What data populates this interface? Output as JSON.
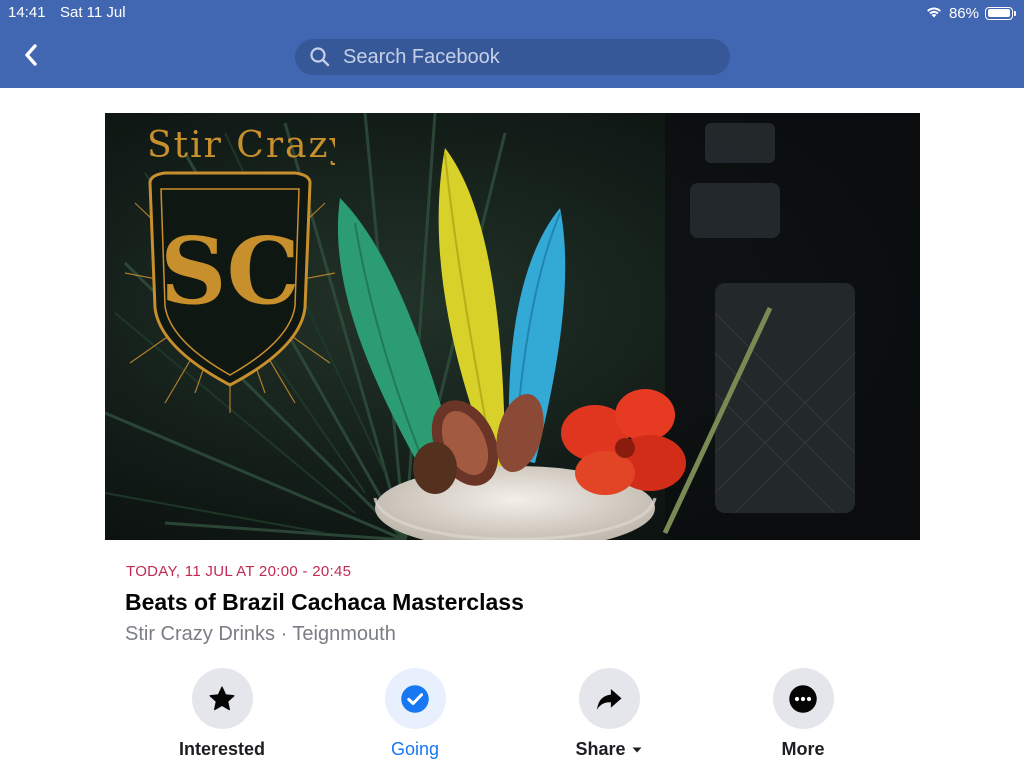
{
  "status_bar": {
    "time": "14:41",
    "date": "Sat 11 Jul",
    "battery": "86%",
    "battery_level": 0.86
  },
  "header": {
    "search_placeholder": "Search Facebook",
    "brand_color": "#4267b2"
  },
  "cover": {
    "logo_text": "Stir Crazy",
    "logo_monogram": "SC"
  },
  "event": {
    "date_time": "TODAY, 11 JUL AT 20:00 - 20:45",
    "title": "Beats of Brazil Cachaca Masterclass",
    "host": "Stir Crazy Drinks · Teignmouth"
  },
  "actions": [
    {
      "label": "Interested",
      "icon": "star-icon",
      "active": false
    },
    {
      "label": "Going",
      "icon": "check-circle-icon",
      "active": true
    },
    {
      "label": "Share",
      "icon": "share-arrow-icon",
      "active": false
    },
    {
      "label": "More",
      "icon": "more-dots-icon",
      "active": false
    }
  ],
  "colors": {
    "date_accent": "#c22a4f",
    "going_active": "#1877f2"
  }
}
